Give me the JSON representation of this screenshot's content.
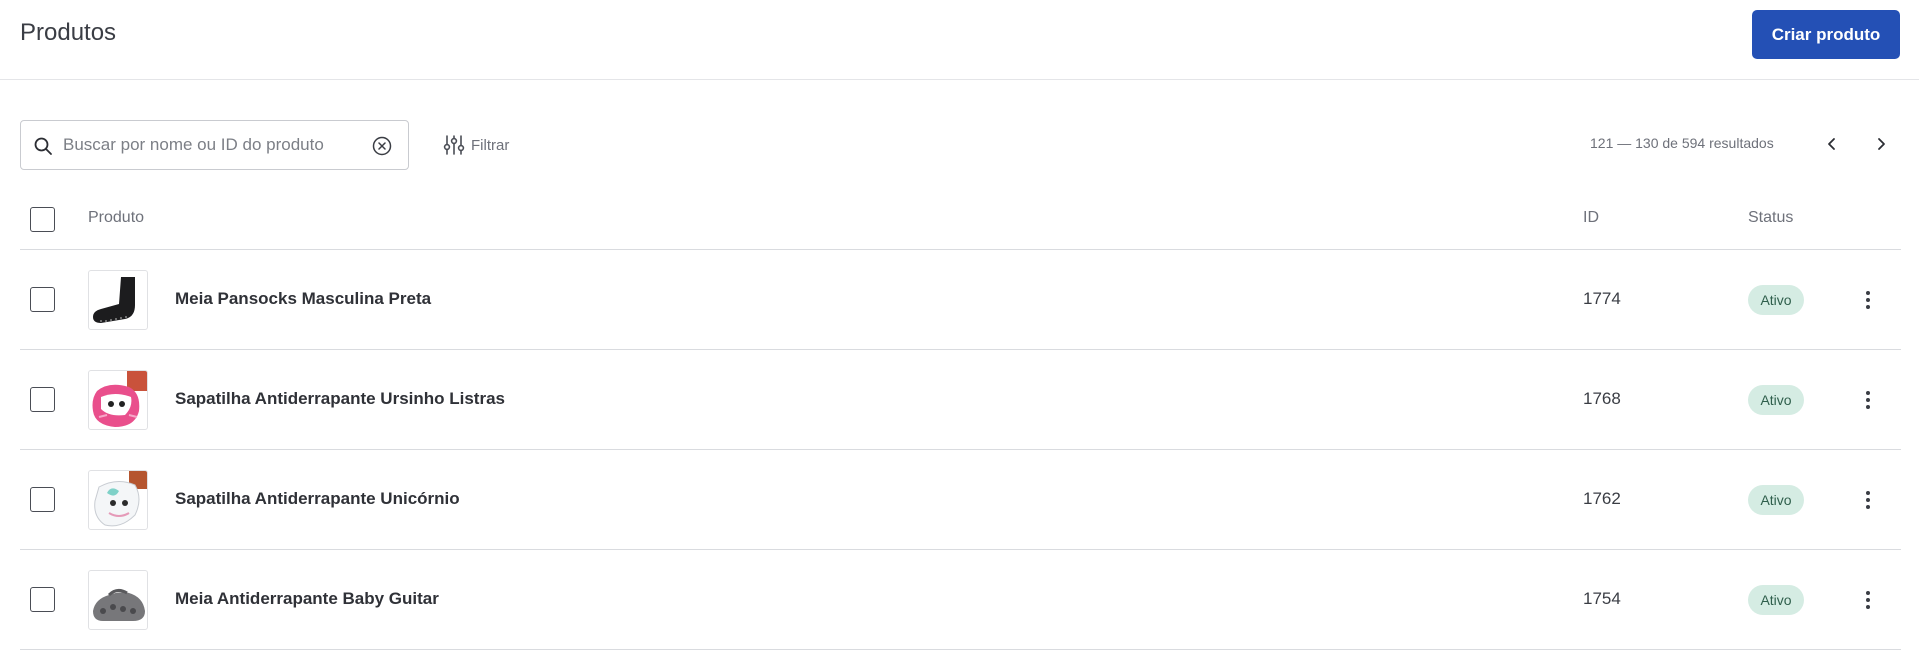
{
  "header": {
    "title": "Produtos",
    "create_button_label": "Criar produto",
    "accent_color": "#2450b5"
  },
  "toolbar": {
    "search_placeholder": "Buscar por nome ou ID do produto",
    "search_value": "",
    "filter_label": "Filtrar",
    "pagination_text": "121 — 130 de 594 resultados",
    "icons": [
      "search-icon",
      "clear-icon",
      "filter-sliders-icon",
      "chevron-left-icon",
      "chevron-right-icon"
    ]
  },
  "table": {
    "columns": [
      "Produto",
      "ID",
      "Status"
    ],
    "rows": [
      {
        "name": "Meia Pansocks Masculina Preta",
        "id": "1774",
        "status": "Ativo",
        "thumbnail": "black-sock"
      },
      {
        "name": "Sapatilha Antiderrapante Ursinho Listras",
        "id": "1768",
        "status": "Ativo",
        "thumbnail": "pink-bear-slipper"
      },
      {
        "name": "Sapatilha Antiderrapante Unicórnio",
        "id": "1762",
        "status": "Ativo",
        "thumbnail": "white-unicorn-slipper"
      },
      {
        "name": "Meia Antiderrapante Baby Guitar",
        "id": "1754",
        "status": "Ativo",
        "thumbnail": "gray-guitar-sock"
      }
    ],
    "status_badge_color": "#d5ece3"
  }
}
